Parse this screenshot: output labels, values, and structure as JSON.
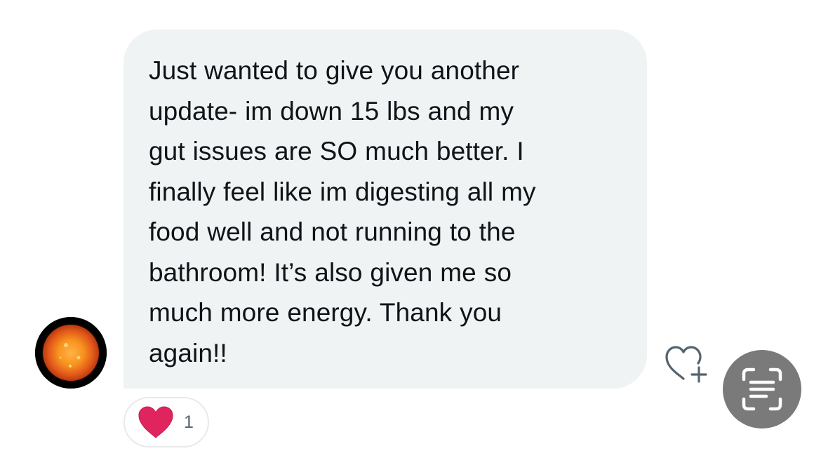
{
  "message": {
    "lines": [
      "Just wanted to give you another",
      "update- im down 15 lbs and my",
      "gut issues are SO much better. I",
      "finally feel like im digesting all my",
      "food well and not running to the",
      "bathroom! It’s also given me so",
      "much more energy. Thank you",
      "again!!"
    ],
    "bubble_color": "#eff3f4",
    "text_color": "#0f1419"
  },
  "reaction": {
    "emoji": "heart-icon",
    "count": "1",
    "heart_color": "#e0245e"
  },
  "actions": {
    "add_reaction_icon": "heart-plus-icon",
    "live_text_icon": "text-scan-icon"
  },
  "avatar": {
    "description_icon": "sun-avatar"
  }
}
